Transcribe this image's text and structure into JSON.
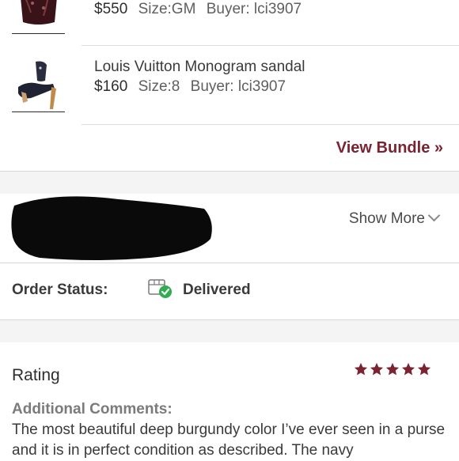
{
  "items": [
    {
      "title": "",
      "price": "$550",
      "size": "Size:GM",
      "buyer": "Buyer: lci3907"
    },
    {
      "title": "Louis Vuitton Monogram sandal",
      "price": "$160",
      "size": "Size:8",
      "buyer": "Buyer: lci3907"
    }
  ],
  "bundle": {
    "view_label": "View Bundle »"
  },
  "shipping": {
    "show_more_label": "Show More"
  },
  "order": {
    "status_label": "Order Status:",
    "status_value": "Delivered",
    "status_icon": "box-delivered-check-icon"
  },
  "rating": {
    "title": "Rating",
    "stars": 5,
    "max_stars": 5,
    "star_color": "#7a2331"
  },
  "comments": {
    "label": "Additional Comments:",
    "text": "The most beautiful deep burgundy color I’ve ever seen in a purse and it is in perfect condition as described. The navy"
  },
  "colors": {
    "accent": "#7a2331",
    "check_green": "#2fae4f"
  }
}
